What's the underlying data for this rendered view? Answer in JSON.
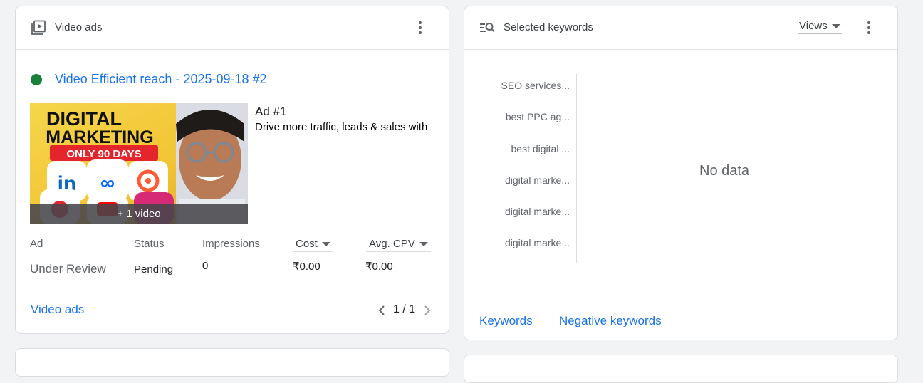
{
  "video_ads_card": {
    "title": "Video ads",
    "icon": "video-library-icon",
    "campaign_name": "Video Efficient reach - 2025-09-18 #2",
    "status_color": "#188038",
    "thumbnail": {
      "line1": "DIGITAL",
      "line2": "MARKETING",
      "banner": "ONLY 90 DAYS",
      "overlay": "+ 1 video"
    },
    "ad_number": "Ad #1",
    "ad_description": "Drive more traffic, leads & sales with",
    "table": {
      "headers": {
        "ad": "Ad",
        "status": "Status",
        "impressions": "Impressions",
        "cost": "Cost",
        "avg_cpv": "Avg. CPV"
      },
      "row": {
        "ad": "Under Review",
        "status": "Pending",
        "impressions": "0",
        "cost": "₹0.00",
        "avg_cpv": "₹0.00"
      }
    },
    "footer_link": "Video ads",
    "pagination": "1 / 1"
  },
  "keywords_card": {
    "title": "Selected keywords",
    "icon": "keyword-search-icon",
    "metric_select": "Views",
    "keywords": [
      "SEO services...",
      "best PPC ag...",
      "best digital ...",
      "digital marke...",
      "digital marke...",
      "digital marke..."
    ],
    "no_data": "No data",
    "link_keywords": "Keywords",
    "link_negative": "Negative keywords"
  },
  "colors": {
    "accent": "#1a73e8",
    "text_secondary": "#5f6368"
  }
}
